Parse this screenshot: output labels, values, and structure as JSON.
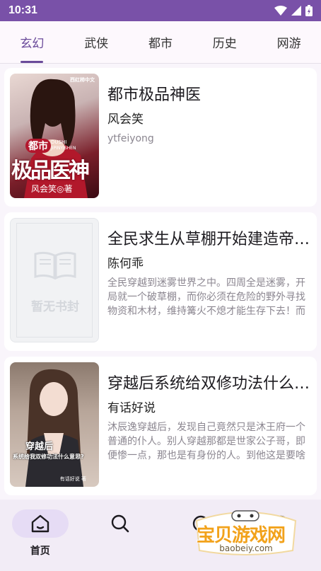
{
  "status": {
    "time": "10:31"
  },
  "tabs": [
    {
      "label": "玄幻",
      "active": true
    },
    {
      "label": "武侠"
    },
    {
      "label": "都市"
    },
    {
      "label": "历史"
    },
    {
      "label": "网游"
    }
  ],
  "books": [
    {
      "title": "都市极品神医",
      "author": "风会笑",
      "description": "ytfeiyong",
      "cover": {
        "badge": "西红柿中文",
        "pinyin1": "DUSHI",
        "pinyin2": "JIPINYISHEN",
        "tag": "都市",
        "big_title": "极品医神",
        "cover_author": "风会笑◎著"
      }
    },
    {
      "title": "全民求生从草棚开始建造帝…",
      "author": "陈何乖",
      "description": "全民穿越到迷雾世界之中。四周全是迷雾，开局就一个破草棚，而你必须在危险的野外寻找物资和木材，维持篝火不熄才能生存下去！而",
      "cover": {
        "placeholder": "暂无书封"
      }
    },
    {
      "title": "穿越后系统给双修功法什么…",
      "author": "有话好说",
      "description": "沐辰逸穿越后，发现自己竟然只是沐王府一个普通的仆人。别人穿越那都是世家公子哥，即便惨一点，那也是有身份的人。到他这是要啥",
      "cover": {
        "line1": "穿越后",
        "line2": "系统给我双修功法什么意思?",
        "cover_author": "有话好说 著"
      }
    }
  ],
  "nav": {
    "home_label": "首页",
    "items": [
      {
        "icon": "home-icon",
        "active": true
      },
      {
        "icon": "search-icon"
      },
      {
        "icon": "bookshelf-icon"
      },
      {
        "icon": "profile-icon"
      }
    ]
  },
  "watermark": {
    "text": "宝贝游戏网",
    "url": "baobeiy.com"
  },
  "colors": {
    "accent": "#6a4a9a",
    "status_bar": "#7951a8",
    "watermark": "#f2a21b"
  }
}
